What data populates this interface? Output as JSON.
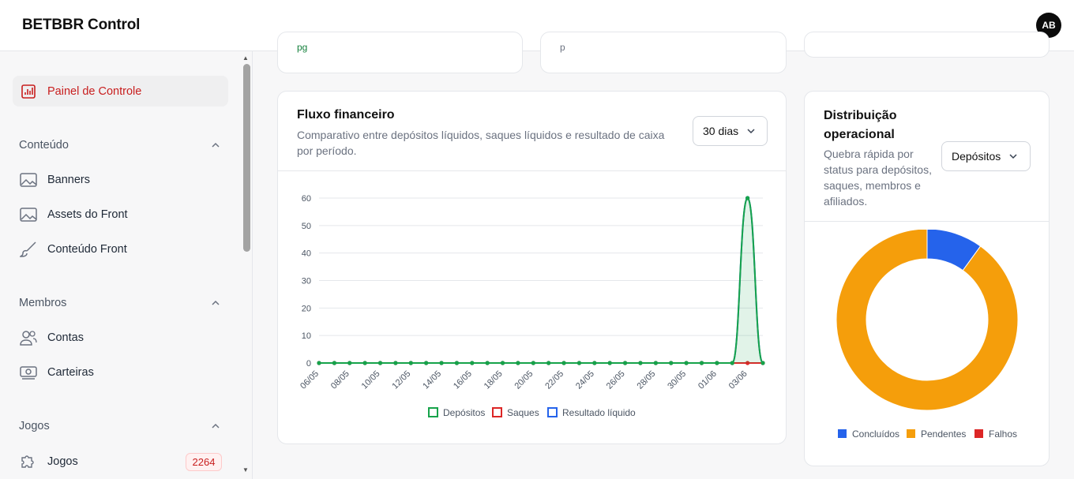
{
  "app": {
    "title": "BETBBR Control",
    "avatar_initials": "AB"
  },
  "sidebar": {
    "active_item": {
      "label": "Painel de Controle",
      "icon": "chart-bars-icon"
    },
    "sections": [
      {
        "title": "Conteúdo",
        "items": [
          {
            "label": "Banners",
            "icon": "image-icon"
          },
          {
            "label": "Assets do Front",
            "icon": "image-icon"
          },
          {
            "label": "Conteúdo Front",
            "icon": "brush-icon"
          }
        ]
      },
      {
        "title": "Membros",
        "items": [
          {
            "label": "Contas",
            "icon": "users-icon"
          },
          {
            "label": "Carteiras",
            "icon": "wallet-icon"
          }
        ]
      },
      {
        "title": "Jogos",
        "items": [
          {
            "label": "Jogos",
            "icon": "puzzle-icon",
            "badge": "2264"
          }
        ]
      }
    ]
  },
  "top_cards": {
    "fragment_1": "pg",
    "fragment_2": "p"
  },
  "flow_card": {
    "title": "Fluxo financeiro",
    "subtitle": "Comparativo entre depósitos líquidos, saques líquidos e resultado de caixa por período.",
    "period_select": "30 dias"
  },
  "distribution_card": {
    "title": "Distribuição operacional",
    "subtitle": "Quebra rápida por status para depósitos, saques, membros e afiliados.",
    "type_select": "Depósitos"
  },
  "chart_data": [
    {
      "type": "area",
      "x_tick_labels": [
        "06/05",
        "08/05",
        "10/05",
        "12/05",
        "14/05",
        "16/05",
        "18/05",
        "20/05",
        "22/05",
        "24/05",
        "26/05",
        "28/05",
        "30/05",
        "01/06",
        "03/06"
      ],
      "x": [
        "06/05",
        "07/05",
        "08/05",
        "09/05",
        "10/05",
        "11/05",
        "12/05",
        "13/05",
        "14/05",
        "15/05",
        "16/05",
        "17/05",
        "18/05",
        "19/05",
        "20/05",
        "21/05",
        "22/05",
        "23/05",
        "24/05",
        "25/05",
        "26/05",
        "27/05",
        "28/05",
        "29/05",
        "30/05",
        "31/05",
        "01/06",
        "02/06",
        "03/06",
        "04/06"
      ],
      "series": [
        {
          "name": "Depósitos",
          "color": "#16a34a",
          "values": [
            0,
            0,
            0,
            0,
            0,
            0,
            0,
            0,
            0,
            0,
            0,
            0,
            0,
            0,
            0,
            0,
            0,
            0,
            0,
            0,
            0,
            0,
            0,
            0,
            0,
            0,
            0,
            0,
            60,
            0
          ]
        },
        {
          "name": "Saques",
          "color": "#dc2626",
          "values": [
            0,
            0,
            0,
            0,
            0,
            0,
            0,
            0,
            0,
            0,
            0,
            0,
            0,
            0,
            0,
            0,
            0,
            0,
            0,
            0,
            0,
            0,
            0,
            0,
            0,
            0,
            0,
            0,
            0,
            0
          ]
        },
        {
          "name": "Resultado líquido",
          "color": "#2563eb",
          "values": [
            0,
            0,
            0,
            0,
            0,
            0,
            0,
            0,
            0,
            0,
            0,
            0,
            0,
            0,
            0,
            0,
            0,
            0,
            0,
            0,
            0,
            0,
            0,
            0,
            0,
            0,
            0,
            0,
            60,
            0
          ]
        }
      ],
      "ylim": [
        0,
        60
      ],
      "y_ticks": [
        0,
        10,
        20,
        30,
        40,
        50,
        60
      ],
      "grid": true,
      "legend": "bottom"
    },
    {
      "type": "pie",
      "donut": true,
      "categories": [
        "Concluídos",
        "Pendentes",
        "Falhos"
      ],
      "values": [
        10,
        90,
        0
      ],
      "colors": [
        "#2563eb",
        "#f59e0b",
        "#dc2626"
      ],
      "legend": "bottom"
    }
  ]
}
